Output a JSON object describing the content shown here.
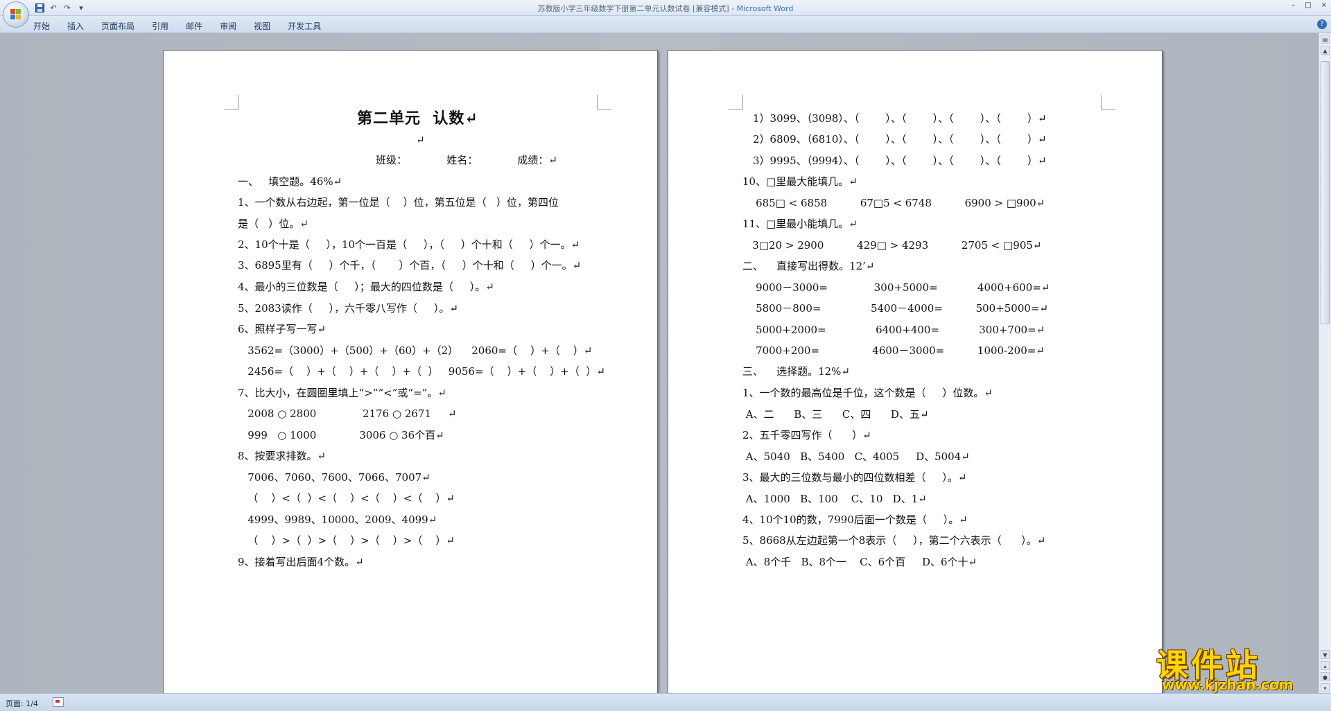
{
  "window": {
    "title_doc": "苏教版小学三年级数学下册第二单元认数试卷 [兼容模式]",
    "title_sep": " - ",
    "title_app": "Microsoft Word",
    "qat": {
      "save_icon": "save-icon",
      "undo_icon": "undo-icon",
      "redo_icon": "redo-icon",
      "customize_icon": "dropdown-icon"
    },
    "controls": {
      "minimize": "–",
      "maximize": "□",
      "close": "×"
    }
  },
  "ribbon": {
    "tabs": [
      "开始",
      "插入",
      "页面布局",
      "引用",
      "邮件",
      "审阅",
      "视图",
      "开发工具"
    ],
    "help": "?"
  },
  "page1": {
    "title": "第二单元  认数↵",
    "lines": [
      "↵",
      "班级：            姓名：            成绩：↵",
      "一、   填空题。46%↵",
      "1、一个数从右边起，第一位是（    ）位，第五位是（   ）位，第四位",
      "是（   ）位。↵",
      "2、10个十是（     ），10个一百是（     ），（     ）个十和（     ）个一。↵",
      "3、6895里有（     ）个千，（       ）个百，（     ）个十和（     ）个一。↵",
      "4、最小的三位数是（     ）；最大的四位数是（     ）。↵",
      "5、2083读作（     ），六千零八写作（     ）。↵",
      "6、照样子写一写↵",
      "   3562=（3000）+（500）+（60）+（2）    2060=（    ）+（    ）↵",
      "   2456=（    ）+（    ）+（    ）+（  ）   9056=（    ）+（    ）+（  ）↵",
      "7、比大小，在圆圈里填上“>”“<”或“=”。↵",
      "   2008 ○ 2800              2176 ○ 2671     ↵",
      "   999   ○ 1000             3006 ○ 36个百↵",
      "8、按要求排数。↵",
      "   7006、7060、7600、7066、7007↵",
      "   （    ）<（  ）<（    ）<（    ）<（    ）↵",
      "   4999、9989、10000、2009、4099↵",
      "   （    ）>（  ）>（    ）>（    ）>（    ）↵",
      "9、接着写出后面4个数。↵"
    ]
  },
  "page2": {
    "lines": [
      "1）3099、（3098）、（        ）、（        ）、（        ）、（        ）↵",
      "2）6809、（6810）、（        ）、（        ）、（        ）、（        ）↵",
      "3）9995、（9994）、（        ）、（        ）、（        ）、（        ）↵",
      "10、□里最大能填几。↵",
      "    685□ < 6858          67□5 < 6748          6900 > □900↵",
      "11、□里最小能填几。↵",
      "   3□20 > 2900          429□ > 4293          2705 < □905↵",
      "二、    直接写出得数。12’↵",
      "    9000－3000=              300+5000=            4000+600=↵",
      "    5800－800=               5400－4000=          500+5000=↵",
      "    5000+2000=               6400+400=            300+700=↵",
      "    7000+200=                4600－3000=          1000-200=↵",
      "三、    选择题。12%↵",
      "1、一个数的最高位是千位，这个数是（     ）位数。↵",
      " A、二      B、三      C、四      D、五↵",
      "2、五千零四写作（      ）↵",
      " A、5040   B、5400   C、4005     D、5004↵",
      "3、最大的三位数与最小的四位数相差（     ）。↵",
      " A、1000   B、100    C、10   D、1↵",
      "4、10个10的数，7990后面一个数是（     ）。↵",
      "5、8668从左边起第一个8表示（     ），第二个六表示（      ）。↵",
      " A、8个千   B、8个一    C、6个百     D、6个十↵"
    ]
  },
  "status": {
    "page": "页面: 1/4",
    "icon": "proofing-icon"
  },
  "watermark": {
    "big": "课件站",
    "small": "www.kjzhan.com"
  }
}
